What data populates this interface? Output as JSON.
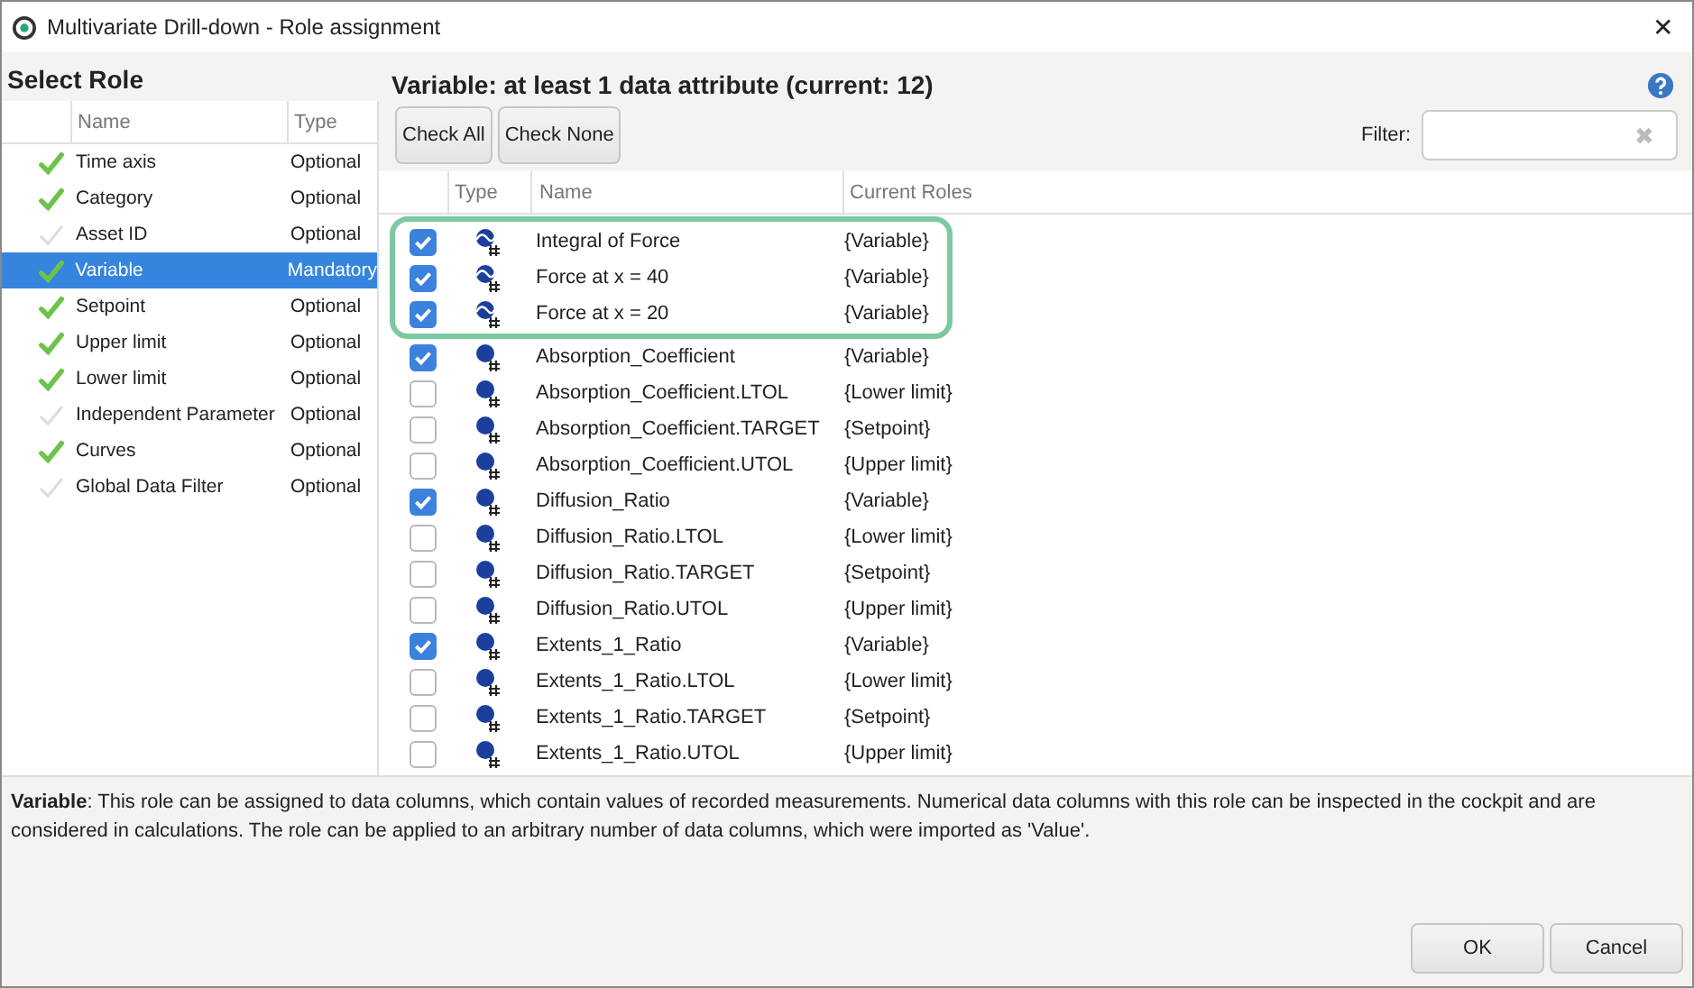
{
  "window": {
    "title": "Multivariate Drill-down - Role assignment",
    "close": "✕"
  },
  "roles": {
    "heading": "Select Role",
    "columns": [
      "Name",
      "Type"
    ],
    "items": [
      {
        "name": "Time axis",
        "type": "Optional",
        "assigned": true,
        "selected": false
      },
      {
        "name": "Category",
        "type": "Optional",
        "assigned": true,
        "selected": false
      },
      {
        "name": "Asset ID",
        "type": "Optional",
        "assigned": false,
        "selected": false
      },
      {
        "name": "Variable",
        "type": "Mandatory",
        "assigned": true,
        "selected": true
      },
      {
        "name": "Setpoint",
        "type": "Optional",
        "assigned": true,
        "selected": false
      },
      {
        "name": "Upper limit",
        "type": "Optional",
        "assigned": true,
        "selected": false
      },
      {
        "name": "Lower limit",
        "type": "Optional",
        "assigned": true,
        "selected": false
      },
      {
        "name": "Independent Parameter",
        "type": "Optional",
        "assigned": false,
        "selected": false
      },
      {
        "name": "Curves",
        "type": "Optional",
        "assigned": true,
        "selected": false
      },
      {
        "name": "Global Data Filter",
        "type": "Optional",
        "assigned": false,
        "selected": false
      }
    ]
  },
  "attributes": {
    "heading": "Variable: at least 1 data attribute (current: 12)",
    "buttons": [
      "Check All",
      "Check None"
    ],
    "filter": {
      "label": "Filter:",
      "clear": "✖"
    },
    "columns": [
      "Type",
      "Name",
      "Current Roles"
    ],
    "highlighted_rows": [
      {
        "kind": "curve",
        "name": "Integral of Force",
        "roles": "{Variable}",
        "checked": true
      },
      {
        "kind": "curve",
        "name": "Force at x = 40",
        "roles": "{Variable}",
        "checked": true
      },
      {
        "kind": "curve",
        "name": "Force at x = 20",
        "roles": "{Variable}",
        "checked": true
      }
    ],
    "rows": [
      {
        "kind": "scalar",
        "name": "Absorption_Coefficient",
        "roles": "{Variable}",
        "checked": true
      },
      {
        "kind": "scalar",
        "name": "Absorption_Coefficient.LTOL",
        "roles": "{Lower limit}",
        "checked": false
      },
      {
        "kind": "scalar",
        "name": "Absorption_Coefficient.TARGET",
        "roles": "{Setpoint}",
        "checked": false
      },
      {
        "kind": "scalar",
        "name": "Absorption_Coefficient.UTOL",
        "roles": "{Upper limit}",
        "checked": false
      },
      {
        "kind": "scalar",
        "name": "Diffusion_Ratio",
        "roles": "{Variable}",
        "checked": true
      },
      {
        "kind": "scalar",
        "name": "Diffusion_Ratio.LTOL",
        "roles": "{Lower limit}",
        "checked": false
      },
      {
        "kind": "scalar",
        "name": "Diffusion_Ratio.TARGET",
        "roles": "{Setpoint}",
        "checked": false
      },
      {
        "kind": "scalar",
        "name": "Diffusion_Ratio.UTOL",
        "roles": "{Upper limit}",
        "checked": false
      },
      {
        "kind": "scalar",
        "name": "Extents_1_Ratio",
        "roles": "{Variable}",
        "checked": true
      },
      {
        "kind": "scalar",
        "name": "Extents_1_Ratio.LTOL",
        "roles": "{Lower limit}",
        "checked": false
      },
      {
        "kind": "scalar",
        "name": "Extents_1_Ratio.TARGET",
        "roles": "{Setpoint}",
        "checked": false
      },
      {
        "kind": "scalar",
        "name": "Extents_1_Ratio.UTOL",
        "roles": "{Upper limit}",
        "checked": false
      }
    ]
  },
  "description": "**Variable**: This role can be assigned to data columns, which contain values of recorded measurements. Numerical data columns with this role can be inspected in the cockpit and are considered in calculations. The role can be applied to an arbitrary number of data columns, which were imported as 'Value'.",
  "footer_buttons": [
    "OK",
    "Cancel"
  ]
}
